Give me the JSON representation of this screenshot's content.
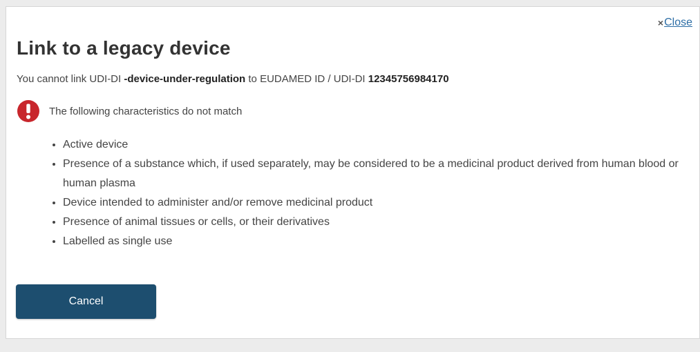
{
  "dialog": {
    "close_symbol": "×",
    "close_label": "Close",
    "title": "Link to a legacy device",
    "subtitle": {
      "prefix": "You cannot link UDI-DI ",
      "udi_di": "-device-under-regulation",
      "middle": " to EUDAMED ID / UDI-DI ",
      "eudamed_id": "12345756984170"
    },
    "warning": {
      "icon": "exclamation-circle-icon",
      "color": "#c8262c",
      "text": "The following characteristics do not match"
    },
    "mismatched_characteristics": [
      "Active device",
      "Presence of a substance which, if used separately, may be considered to be a medicinal product derived from human blood or human plasma",
      "Device intended to administer and/or remove medicinal product",
      "Presence of animal tissues or cells, or their derivatives",
      "Labelled as single use"
    ],
    "cancel_label": "Cancel",
    "cancel_color": "#1d4e6f"
  }
}
